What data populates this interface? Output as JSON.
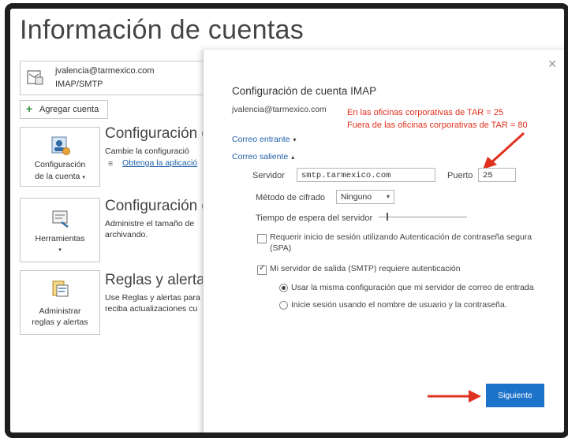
{
  "page": {
    "title": "Información de cuentas"
  },
  "account": {
    "email": "jvalencia@tarmexico.com",
    "type": "IMAP/SMTP"
  },
  "add_account": {
    "label": "Agregar cuenta"
  },
  "sections": [
    {
      "tile_label_1": "Configuración",
      "tile_label_2": "de la cuenta",
      "title": "Configuración d",
      "text_1": "Cambie la configuració",
      "link": "Obtenga la aplicació"
    },
    {
      "tile_label_1": "Herramientas",
      "title": "Configuración d",
      "text_1": "Administre el tamaño de",
      "text_2": "archivando."
    },
    {
      "tile_label_1": "Administrar",
      "tile_label_2": "reglas y alertas",
      "title": "Reglas y alertas",
      "text_1": "Use Reglas y alertas para",
      "text_2": "reciba actualizaciones cu"
    }
  ],
  "dialog": {
    "title": "Configuración de cuenta IMAP",
    "email": "jvalencia@tarmexico.com",
    "annotation_1": "En las oficinas corporativas de TAR = 25",
    "annotation_2": "Fuera de las oficinas corporativas de TAR = 80",
    "incoming_label": "Correo entrante",
    "outgoing_label": "Correo saliente",
    "server_label": "Servidor",
    "server_value": "smtp.tarmexico.com",
    "port_label": "Puerto",
    "port_value": "25",
    "encryption_label": "Método de cifrado",
    "encryption_value": "Ninguno",
    "timeout_label": "Tiempo de espera del servidor",
    "timeout_level": 0.05,
    "spa_label_1": "Requerir inicio de sesión utilizando Autenticación de contraseña segura",
    "spa_label_2": "(SPA)",
    "spa_checked": false,
    "smtp_auth_label": "Mi servidor de salida (SMTP) requiere autenticación",
    "smtp_auth_checked": true,
    "radio_same_label": "Usar la misma configuración que mi servidor de correo de entrada",
    "radio_login_label": "Inicie sesión usando el nombre de usuario y la contraseña.",
    "next_label": "Siguiente"
  },
  "colors": {
    "accent": "#1c73c9",
    "annotation": "#e0301e",
    "link": "#1e5fa8"
  },
  "icons": [
    "account-mail-icon",
    "plus-icon",
    "account-settings-icon",
    "tools-icon",
    "rules-alerts-icon",
    "close-icon",
    "chevron-down-icon",
    "chevron-up-icon",
    "dropdown-icon",
    "annotation-arrow-icon"
  ]
}
